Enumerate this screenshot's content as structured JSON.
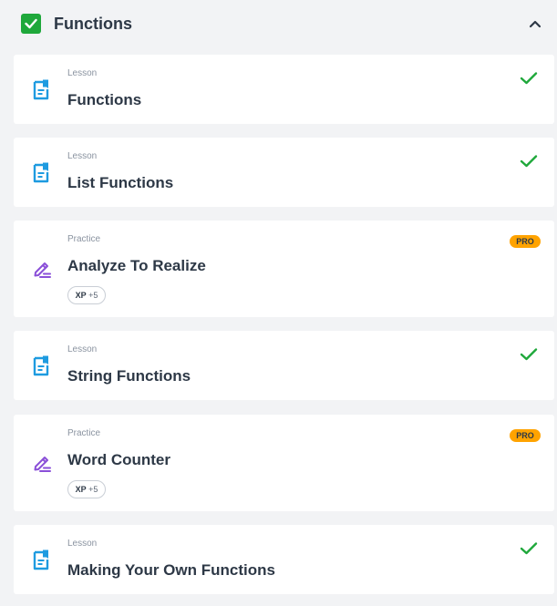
{
  "section": {
    "title": "Functions",
    "completed": true,
    "expanded": true
  },
  "items": [
    {
      "type": "Lesson",
      "title": "Functions",
      "status": "completed"
    },
    {
      "type": "Lesson",
      "title": "List Functions",
      "status": "completed"
    },
    {
      "type": "Practice",
      "title": "Analyze To Realize",
      "badge": "PRO",
      "xp_label": "XP",
      "xp_value": "+5"
    },
    {
      "type": "Lesson",
      "title": "String Functions",
      "status": "completed"
    },
    {
      "type": "Practice",
      "title": "Word Counter",
      "badge": "PRO",
      "xp_label": "XP",
      "xp_value": "+5"
    },
    {
      "type": "Lesson",
      "title": "Making Your Own Functions",
      "status": "completed"
    }
  ],
  "icons": {
    "section_check": "checkbox-checked-icon",
    "collapse": "chevron-up-icon",
    "lesson": "lesson-document-icon",
    "practice": "practice-pencil-icon",
    "completed": "checkmark-icon"
  },
  "colors": {
    "success": "#1fa83b",
    "lesson_icon": "#1e9be0",
    "practice_icon": "#8a4fd8",
    "pro_badge": "#ffa300",
    "background": "#f2f3f5",
    "card": "#ffffff"
  }
}
